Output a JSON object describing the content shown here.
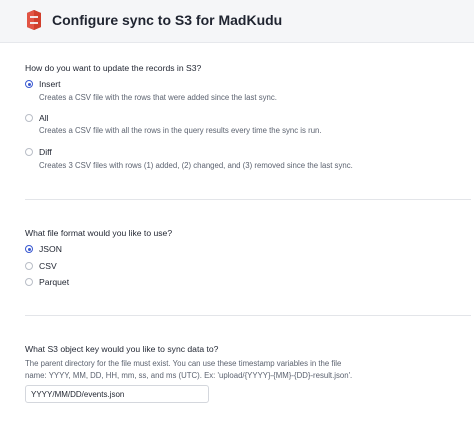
{
  "header": {
    "title": "Configure sync to S3 for MadKudu",
    "logo_icon": "aws-s3-icon"
  },
  "update_mode": {
    "question": "How do you want to update the records in S3?",
    "options": [
      {
        "label": "Insert",
        "description": "Creates a CSV file with the rows that were added since the last sync.",
        "checked": true
      },
      {
        "label": "All",
        "description": "Creates a CSV file with all the rows in the query results every time the sync is run.",
        "checked": false
      },
      {
        "label": "Diff",
        "description": "Creates 3 CSV files with rows (1) added, (2) changed, and (3) removed since the last sync.",
        "checked": false
      }
    ]
  },
  "file_format": {
    "question": "What file format would you like to use?",
    "options": [
      {
        "label": "JSON",
        "checked": true
      },
      {
        "label": "CSV",
        "checked": false
      },
      {
        "label": "Parquet",
        "checked": false
      }
    ]
  },
  "object_key": {
    "question": "What S3 object key would you like to sync data to?",
    "help_line1": "The parent directory for the file must exist. You can use these timestamp variables in the file",
    "help_line2": "name: YYYY, MM, DD, HH, mm, ss, and ms (UTC). Ex: 'upload/{YYYY}-{MM}-{DD}-result.json'.",
    "value": "YYYY/MM/DD/events.json"
  },
  "colors": {
    "accent": "#3a59d1",
    "header_bg": "#f5f6f8",
    "s3_red": "#d13f2c"
  }
}
